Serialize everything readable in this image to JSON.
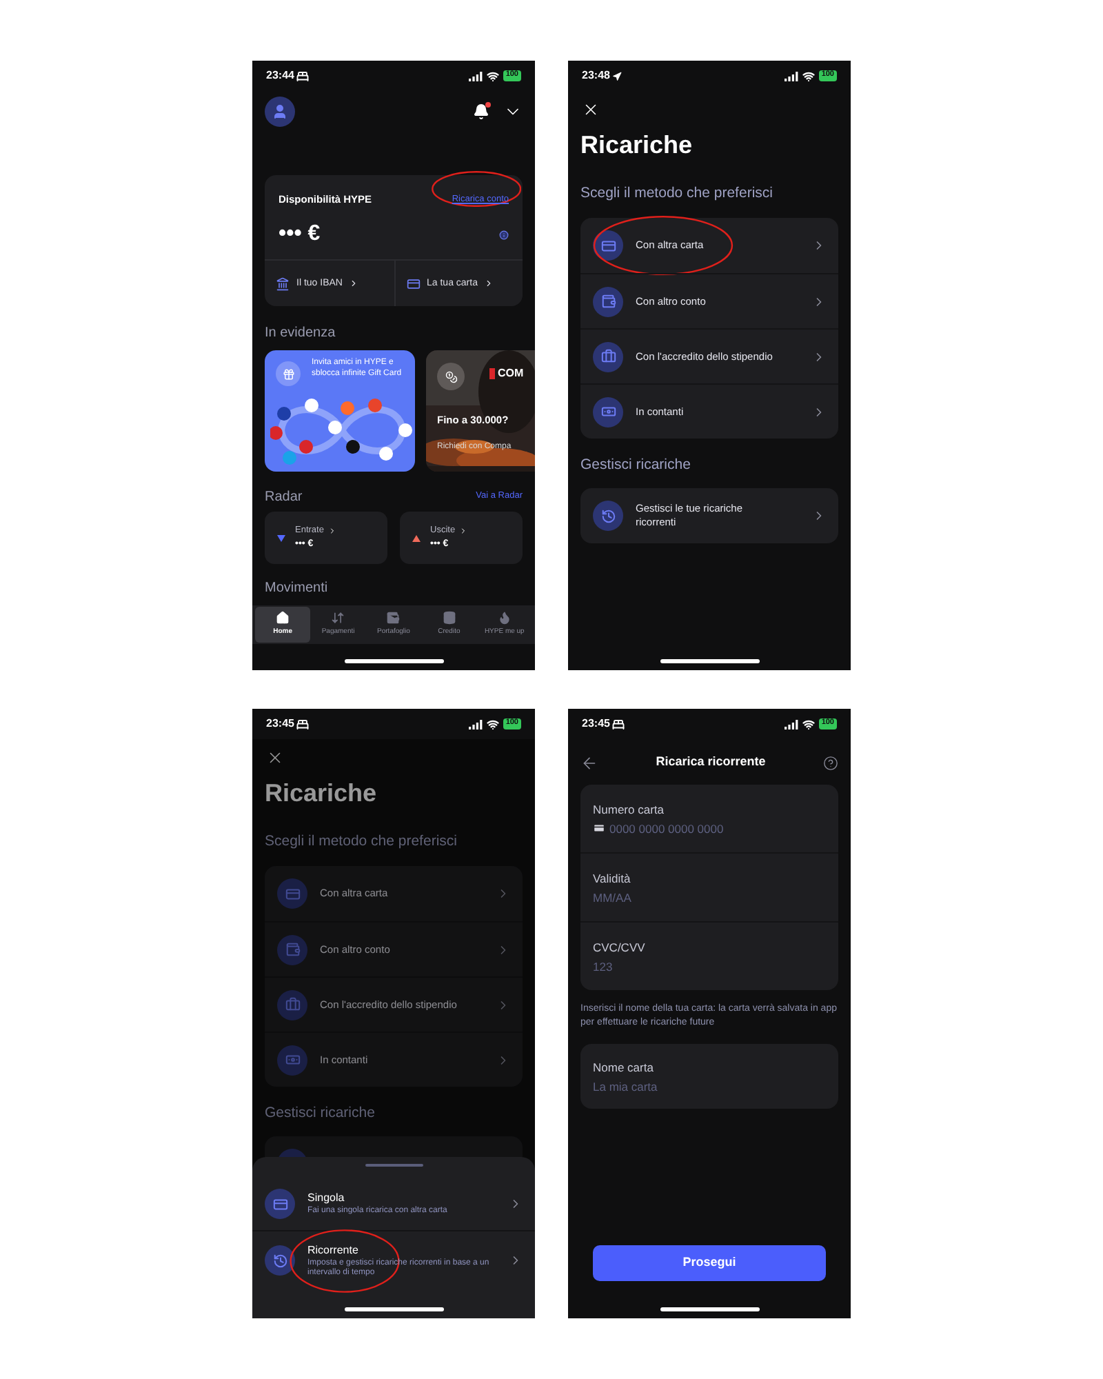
{
  "screens": [
    {
      "kind": "home",
      "status_bar": {
        "kind": "bed",
        "time": "23:44",
        "battery": "100"
      },
      "balance_card": {
        "title": "Disponibilità HYPE",
        "link": {
          "label": "Ricarica conto",
          "circled": true
        },
        "amount": "••• €",
        "shortcuts": [
          {
            "kind": "bank",
            "label": "Il tuo IBAN"
          },
          {
            "kind": "card",
            "label": "La tua carta"
          }
        ]
      },
      "highlights_title": "In evidenza",
      "promos": [
        {
          "kind": "invite",
          "text": "Invita amici in HYPE e sblocca infinite Gift Card"
        },
        {
          "logo": "COM",
          "headline": "Fino a 30.000?",
          "subtitle": "Richiedi con Compa"
        }
      ],
      "radar": {
        "title": "Radar",
        "link": "Vai a Radar",
        "cards": [
          {
            "kind": "in",
            "label": "Entrate",
            "amount": "••• €"
          },
          {
            "kind": "out",
            "label": "Uscite",
            "amount": "••• €"
          }
        ]
      },
      "movements_title": "Movimenti",
      "tabs": [
        {
          "label": "Home",
          "selected": true
        },
        {
          "label": "Pagamenti",
          "selected": false
        },
        {
          "label": "Portafoglio",
          "selected": false
        },
        {
          "label": "Credito",
          "selected": false
        },
        {
          "label": "HYPE me up",
          "selected": false
        }
      ]
    },
    {
      "kind": "methods",
      "dimmed": false,
      "status_bar": {
        "kind": "location",
        "time": "23:48",
        "battery": "100"
      },
      "title": "Ricariche",
      "section_1": "Scegli il metodo che preferisci",
      "methods": [
        {
          "kind": "card",
          "label": "Con altra carta",
          "circled": true
        },
        {
          "kind": "account",
          "label": "Con altro conto",
          "circled": false
        },
        {
          "kind": "salary",
          "label": "Con l'accredito dello stipendio",
          "circled": false
        },
        {
          "kind": "cash",
          "label": "In contanti",
          "circled": false
        }
      ],
      "section_2": "Gestisci ricariche",
      "manage": {
        "label": "Gestisci le tue ricariche ricorrenti"
      }
    },
    {
      "kind": "methods",
      "dimmed": true,
      "status_bar": {
        "kind": "bed",
        "time": "23:45",
        "battery": "100"
      },
      "title": "Ricariche",
      "section_1": "Scegli il metodo che preferisci",
      "methods": [
        {
          "kind": "card",
          "label": "Con altra carta",
          "circled": false
        },
        {
          "kind": "account",
          "label": "Con altro conto",
          "circled": false
        },
        {
          "kind": "salary",
          "label": "Con l'accredito dello stipendio",
          "circled": false
        },
        {
          "kind": "cash",
          "label": "In contanti",
          "circled": false
        }
      ],
      "section_2": "Gestisci ricariche",
      "sheet": {
        "options": [
          {
            "kind": "single",
            "title": "Singola",
            "subtitle": "Fai una singola ricarica con altra carta",
            "circled": false
          },
          {
            "kind": "recurring",
            "title": "Ricorrente",
            "subtitle": "Imposta e gestisci ricariche ricorrenti in base a un intervallo di tempo",
            "circled": true
          }
        ]
      }
    },
    {
      "kind": "form",
      "status_bar": {
        "kind": "bed",
        "time": "23:45",
        "battery": "100"
      },
      "title": "Ricarica ricorrente",
      "fields": [
        {
          "kind": "card_number",
          "label": "Numero carta",
          "placeholder": "0000 0000 0000 0000"
        },
        {
          "kind": "text",
          "label": "Validità",
          "placeholder": "MM/AA"
        },
        {
          "kind": "text",
          "label": "CVC/CVV",
          "placeholder": "123"
        }
      ],
      "note": "Inserisci il nome della tua carta: la carta verrà salvata in app per effettuare le ricariche future",
      "name_field": {
        "label": "Nome carta",
        "placeholder": "La mia carta"
      },
      "button": "Prosegui"
    }
  ]
}
